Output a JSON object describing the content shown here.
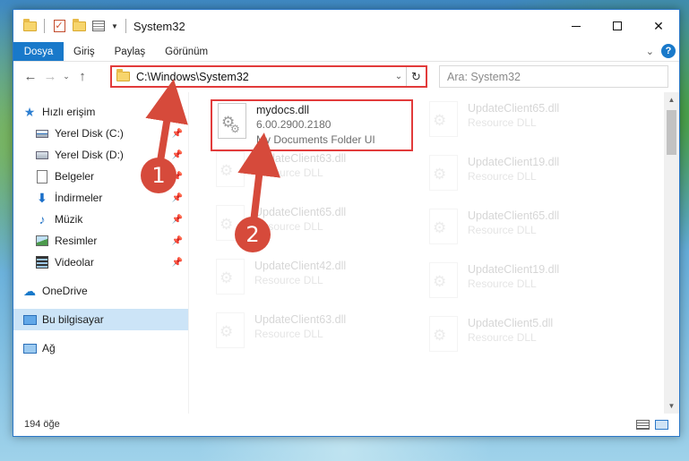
{
  "window": {
    "title": "System32",
    "controls": {
      "minimize": "–",
      "maximize": "□",
      "close": "✕"
    }
  },
  "ribbon": {
    "tabs": [
      {
        "label": "Dosya",
        "active": true
      },
      {
        "label": "Giriş"
      },
      {
        "label": "Paylaş"
      },
      {
        "label": "Görünüm"
      }
    ],
    "help": "?"
  },
  "navbar": {
    "back": "←",
    "forward": "→",
    "recent": "⌄",
    "up": "↑",
    "address": "C:\\Windows\\System32",
    "search_placeholder": "Ara: System32"
  },
  "sidebar": {
    "quick_access": "Hızlı erişim",
    "items": [
      {
        "label": "Yerel Disk (C:)",
        "icon": "drive-c-icon"
      },
      {
        "label": "Yerel Disk (D:)",
        "icon": "drive-d-icon"
      },
      {
        "label": "Belgeler",
        "icon": "documents-icon"
      },
      {
        "label": "İndirmeler",
        "icon": "downloads-icon"
      },
      {
        "label": "Müzik",
        "icon": "music-icon"
      },
      {
        "label": "Resimler",
        "icon": "pictures-icon"
      },
      {
        "label": "Videolar",
        "icon": "videos-icon"
      }
    ],
    "onedrive": "OneDrive",
    "this_pc": "Bu bilgisayar",
    "network": "Ağ"
  },
  "files": [
    {
      "name": "mydocs.dll",
      "version": "6.00.2900.2180",
      "desc": "My Documents Folder UI"
    },
    {
      "name": "UpdateClient65.dll",
      "desc": "Resource DLL"
    },
    {
      "name": "UpdateClient63.dll",
      "desc": "Resource DLL"
    },
    {
      "name": "UpdateClient19.dll",
      "desc": "Resource DLL"
    },
    {
      "name": "UpdateClient65.dll",
      "desc": "Resource DLL"
    },
    {
      "name": "UpdateClient65.dll",
      "desc": "Resource DLL"
    },
    {
      "name": "UpdateClient42.dll",
      "desc": "Resource DLL"
    },
    {
      "name": "UpdateClient19.dll",
      "desc": "Resource DLL"
    },
    {
      "name": "UpdateClient63.dll",
      "desc": "Resource DLL"
    },
    {
      "name": "UpdateClient5.dll",
      "desc": "Resource DLL"
    }
  ],
  "status": {
    "count": "194 öğe"
  },
  "annotations": {
    "step1": "1",
    "step2": "2"
  },
  "colors": {
    "accent": "#1979ca",
    "highlight": "#e23b3b",
    "badge": "#d64a3b"
  }
}
